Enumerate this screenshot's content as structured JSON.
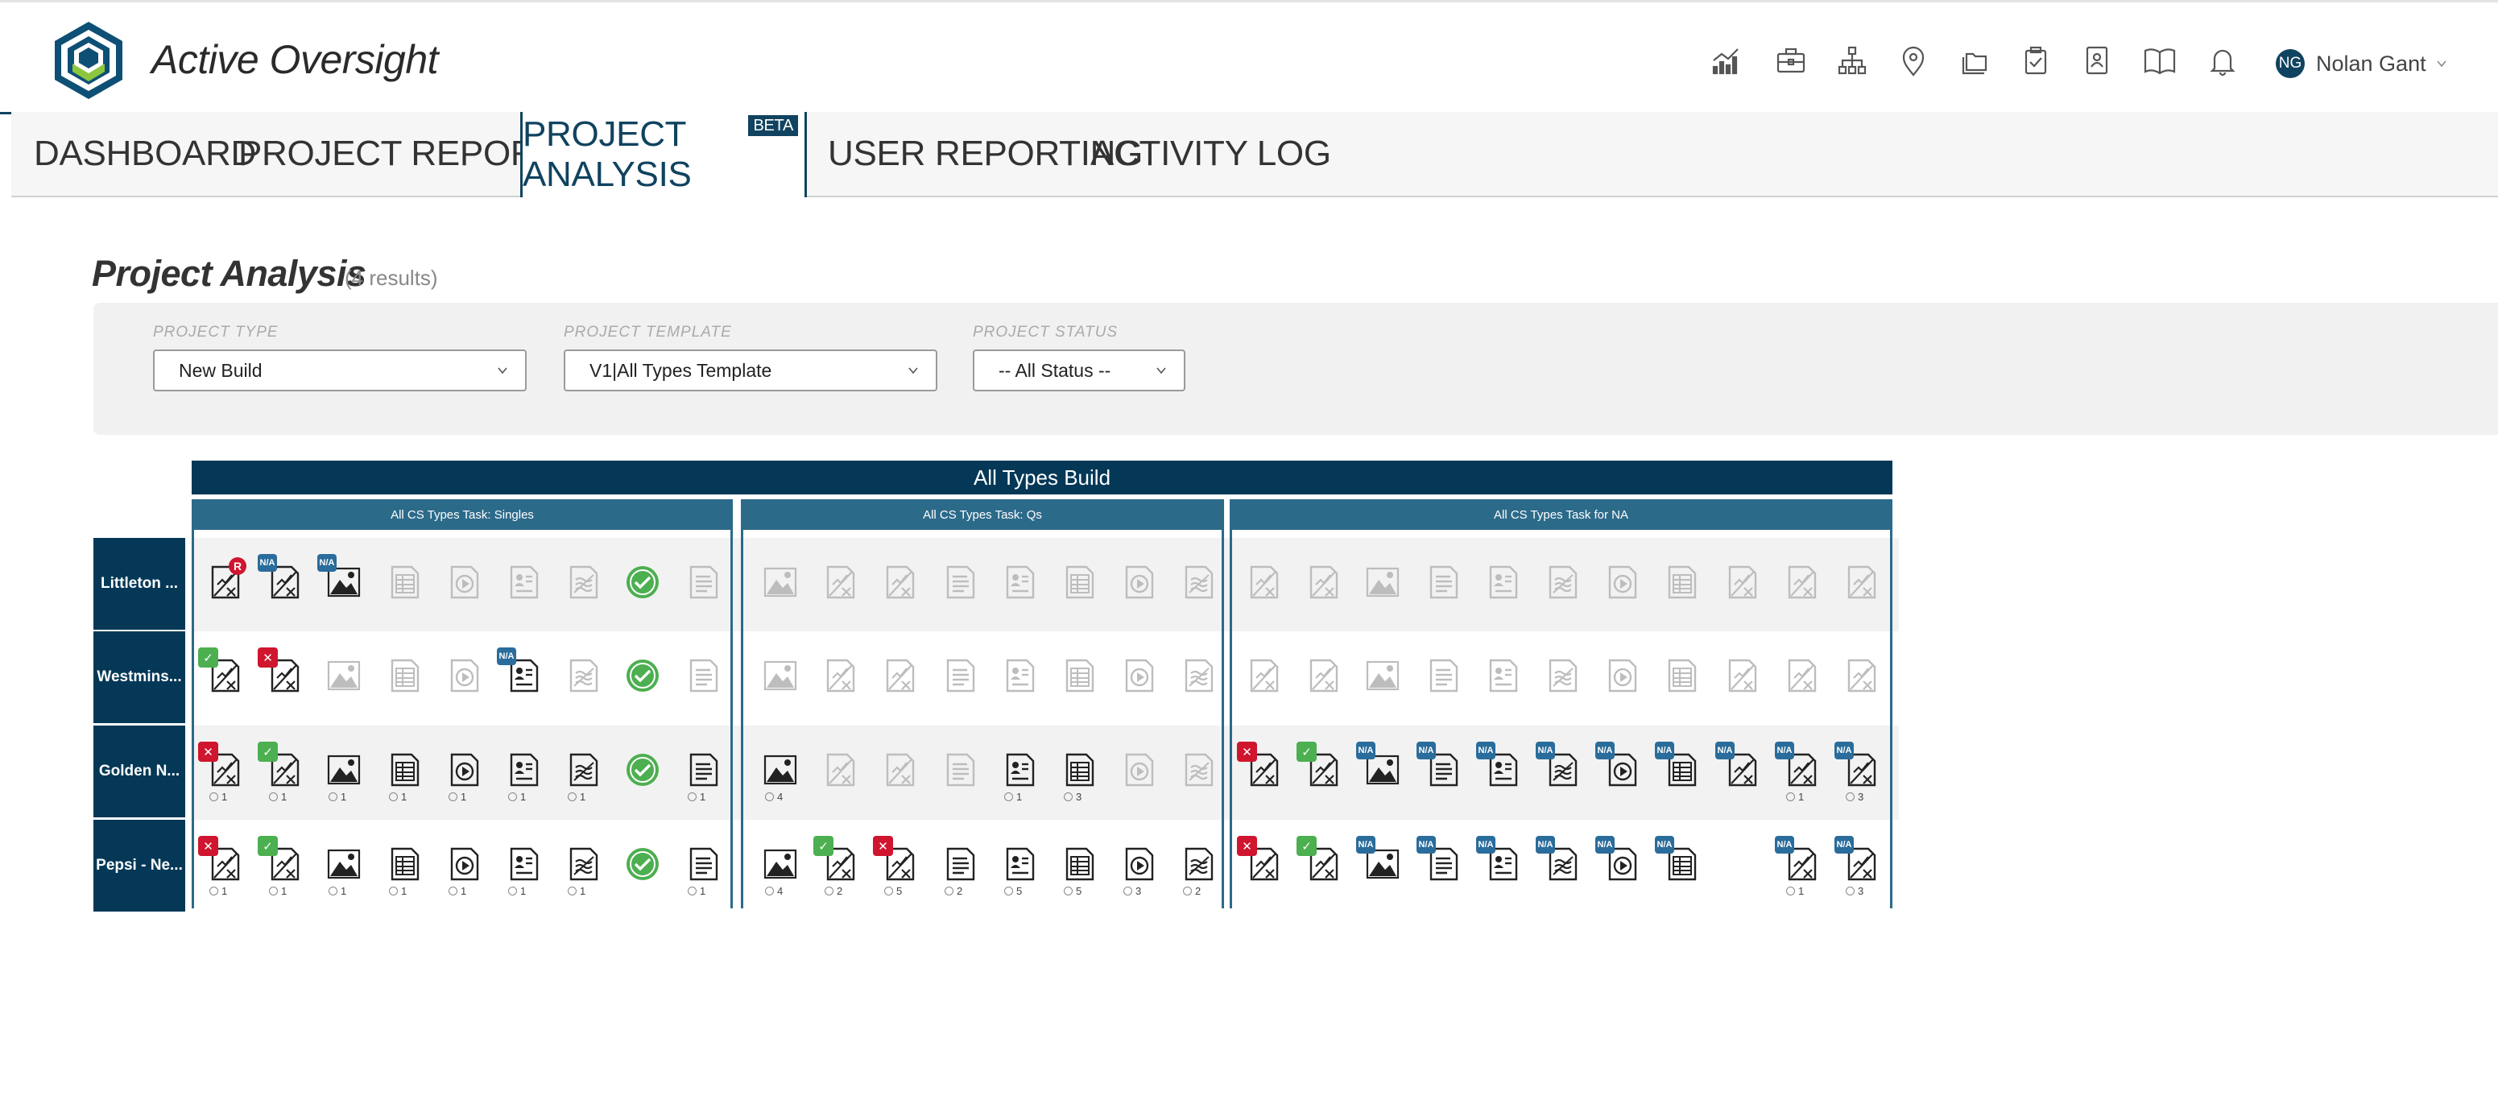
{
  "app": {
    "brand": "Active Oversight",
    "colors": {
      "navy": "#053857",
      "section": "#2c6a8a",
      "accent": "#10435f",
      "green": "#4caf50",
      "red": "#d0152f"
    }
  },
  "header": {
    "icons": [
      "chart-line-icon",
      "briefcase-icon",
      "org-chart-icon",
      "map-pin-icon",
      "folders-icon",
      "clipboard-check-icon",
      "contact-book-icon",
      "book-open-icon",
      "bell-icon"
    ],
    "user": {
      "initials": "NG",
      "name": "Nolan Gant"
    }
  },
  "nav": {
    "tabs": [
      {
        "label": "DASHBOARD"
      },
      {
        "label": "PROJECT REPORTING"
      },
      {
        "label": "PROJECT ANALYSIS",
        "badge": "BETA",
        "active": true
      },
      {
        "label": "USER REPORTING"
      },
      {
        "label": "ACTIVITY LOG"
      }
    ]
  },
  "page": {
    "title": "Project Analysis",
    "count": "(4 results)"
  },
  "filters": {
    "type": {
      "label": "PROJECT TYPE",
      "value": "New Build"
    },
    "template": {
      "label": "PROJECT TEMPLATE",
      "value": "V1|All Types Template"
    },
    "status": {
      "label": "PROJECT STATUS",
      "value": "-- All Status --"
    }
  },
  "grid": {
    "title": "All Types Build",
    "sections": [
      {
        "title": "All CS Types Task: Singles",
        "icons": [
          "sig",
          "sig",
          "img",
          "tbl",
          "play",
          "prof",
          "stack",
          "check",
          "doc"
        ]
      },
      {
        "title": "All CS Types Task: Qs",
        "icons": [
          "img",
          "sig",
          "sig",
          "doc",
          "prof",
          "tbl",
          "play",
          "stack"
        ]
      },
      {
        "title": "All CS Types Task for NA",
        "icons": [
          "sig",
          "sig",
          "img",
          "doc",
          "prof",
          "stack",
          "play",
          "tbl",
          "sig",
          "sig",
          "sig"
        ]
      }
    ],
    "rows": [
      {
        "label": "Littleton ...",
        "cells": [
          [
            {
              "a": 1,
              "b": "r"
            },
            {
              "a": 1,
              "b": "na"
            },
            {
              "a": 1,
              "b": "na"
            },
            {
              "a": 0
            },
            {
              "a": 0
            },
            {
              "a": 0
            },
            {
              "a": 0
            },
            {
              "a": 1
            },
            {
              "a": 0
            }
          ],
          [
            {
              "a": 0
            },
            {
              "a": 0
            },
            {
              "a": 0
            },
            {
              "a": 0
            },
            {
              "a": 0
            },
            {
              "a": 0
            },
            {
              "a": 0
            },
            {
              "a": 0
            }
          ],
          [
            {
              "a": 0
            },
            {
              "a": 0
            },
            {
              "a": 0
            },
            {
              "a": 0
            },
            {
              "a": 0
            },
            {
              "a": 0
            },
            {
              "a": 0
            },
            {
              "a": 0
            },
            {
              "a": 0
            },
            {
              "a": 0
            },
            {
              "a": 0
            }
          ]
        ]
      },
      {
        "label": "Westmins...",
        "cells": [
          [
            {
              "a": 1,
              "b": "green"
            },
            {
              "a": 1,
              "b": "red"
            },
            {
              "a": 0
            },
            {
              "a": 0
            },
            {
              "a": 0
            },
            {
              "a": 1,
              "b": "na"
            },
            {
              "a": 0
            },
            {
              "a": 1
            },
            {
              "a": 0
            }
          ],
          [
            {
              "a": 0
            },
            {
              "a": 0
            },
            {
              "a": 0
            },
            {
              "a": 0
            },
            {
              "a": 0
            },
            {
              "a": 0
            },
            {
              "a": 0
            },
            {
              "a": 0
            }
          ],
          [
            {
              "a": 0
            },
            {
              "a": 0
            },
            {
              "a": 0
            },
            {
              "a": 0
            },
            {
              "a": 0
            },
            {
              "a": 0
            },
            {
              "a": 0
            },
            {
              "a": 0
            },
            {
              "a": 0
            },
            {
              "a": 0
            },
            {
              "a": 0
            }
          ]
        ]
      },
      {
        "label": "Golden N...",
        "cells": [
          [
            {
              "a": 1,
              "b": "red",
              "c": "1"
            },
            {
              "a": 1,
              "b": "green",
              "c": "1"
            },
            {
              "a": 1,
              "c": "1"
            },
            {
              "a": 1,
              "c": "1"
            },
            {
              "a": 1,
              "c": "1"
            },
            {
              "a": 1,
              "c": "1"
            },
            {
              "a": 1,
              "c": "1"
            },
            {
              "a": 1
            },
            {
              "a": 1,
              "c": "1"
            }
          ],
          [
            {
              "a": 1,
              "c": "4"
            },
            {
              "a": 0
            },
            {
              "a": 0
            },
            {
              "a": 0
            },
            {
              "a": 1,
              "c": "1"
            },
            {
              "a": 1,
              "c": "3"
            },
            {
              "a": 0
            },
            {
              "a": 0
            }
          ],
          [
            {
              "a": 1,
              "b": "red"
            },
            {
              "a": 1,
              "b": "green"
            },
            {
              "a": 1,
              "b": "na"
            },
            {
              "a": 1,
              "b": "na"
            },
            {
              "a": 1,
              "b": "na"
            },
            {
              "a": 1,
              "b": "na"
            },
            {
              "a": 1,
              "b": "na"
            },
            {
              "a": 1,
              "b": "na"
            },
            {
              "a": 1,
              "b": "na"
            },
            {
              "a": 1,
              "b": "na",
              "c": "1"
            },
            {
              "a": 1,
              "b": "na",
              "c": "3"
            }
          ]
        ]
      },
      {
        "label": "Pepsi - Ne...",
        "cells": [
          [
            {
              "a": 1,
              "b": "red",
              "c": "1"
            },
            {
              "a": 1,
              "b": "green",
              "c": "1"
            },
            {
              "a": 1,
              "c": "1"
            },
            {
              "a": 1,
              "c": "1"
            },
            {
              "a": 1,
              "c": "1"
            },
            {
              "a": 1,
              "c": "1"
            },
            {
              "a": 1,
              "c": "1"
            },
            {
              "a": 1
            },
            {
              "a": 1,
              "c": "1"
            }
          ],
          [
            {
              "a": 1,
              "c": "4"
            },
            {
              "a": 1,
              "b": "green",
              "c": "2"
            },
            {
              "a": 1,
              "b": "red",
              "c": "5"
            },
            {
              "a": 1,
              "c": "2"
            },
            {
              "a": 1,
              "c": "5"
            },
            {
              "a": 1,
              "c": "5"
            },
            {
              "a": 1,
              "c": "3"
            },
            {
              "a": 1,
              "c": "2"
            }
          ],
          [
            {
              "a": 1,
              "b": "red"
            },
            {
              "a": 1,
              "b": "green"
            },
            {
              "a": 1,
              "b": "na"
            },
            {
              "a": 1,
              "b": "na"
            },
            {
              "a": 1,
              "b": "na"
            },
            {
              "a": 1,
              "b": "na"
            },
            {
              "a": 1,
              "b": "na"
            },
            {
              "a": 1,
              "b": "na"
            },
            {
              "h": 1
            },
            {
              "a": 1,
              "b": "na",
              "c": "1"
            },
            {
              "a": 1,
              "b": "na",
              "c": "3"
            }
          ]
        ]
      }
    ],
    "badge_text": {
      "green": "✓",
      "red": "✕",
      "na": "N/A",
      "r": "R"
    }
  }
}
